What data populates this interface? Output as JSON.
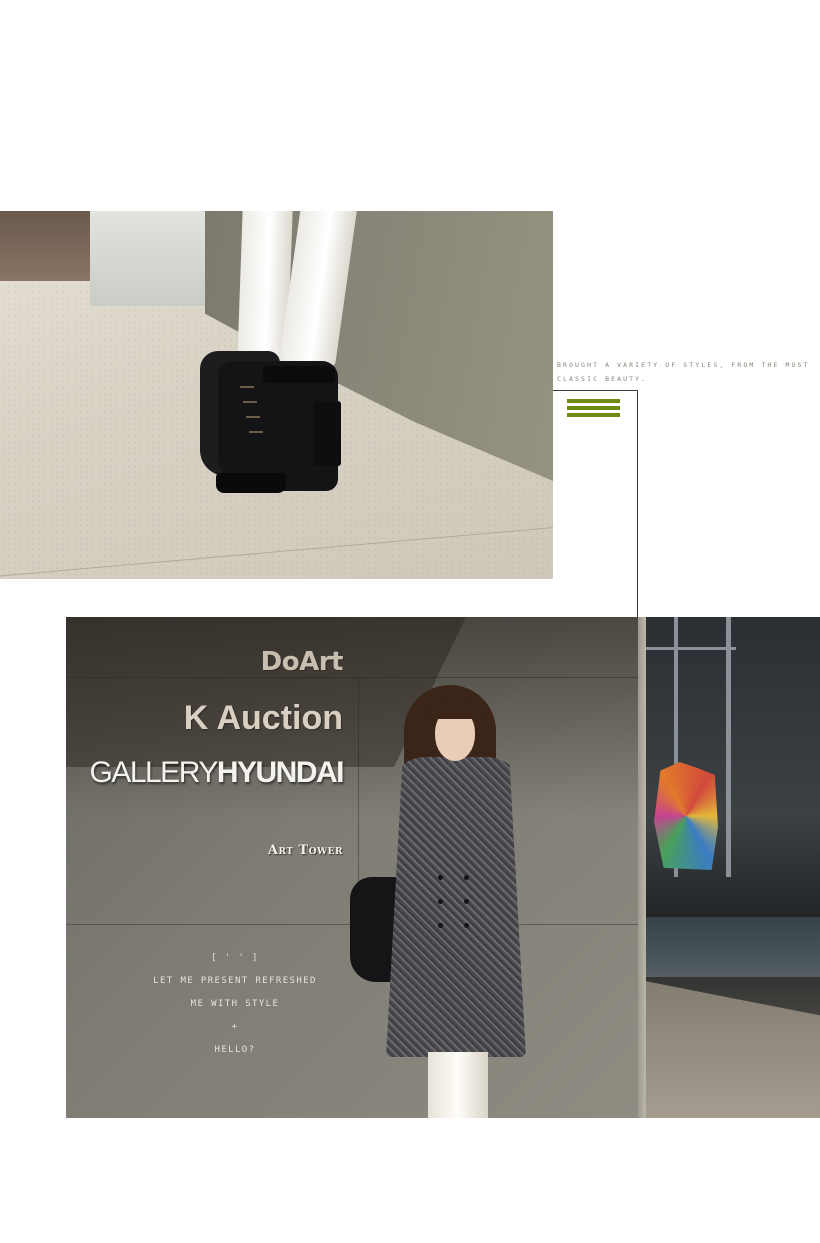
{
  "caption": {
    "text": "BROUGHT A VARIETY OF STYLES, FROM THE MOST CLASSIC BEAUTY."
  },
  "accent_color": "#6e8a12",
  "sign": {
    "line1": "DoArt",
    "line2": "K Auction",
    "line3_regular": "GALLERY",
    "line3_bold": "HYUNDAI",
    "line4": "Art Tower"
  },
  "poem": {
    "bracket": "[ ' ' ]",
    "line1": "LET ME PRESENT REFRESHED",
    "line2": "ME WITH STYLE",
    "plus": "+",
    "line3": "HELLO?"
  }
}
